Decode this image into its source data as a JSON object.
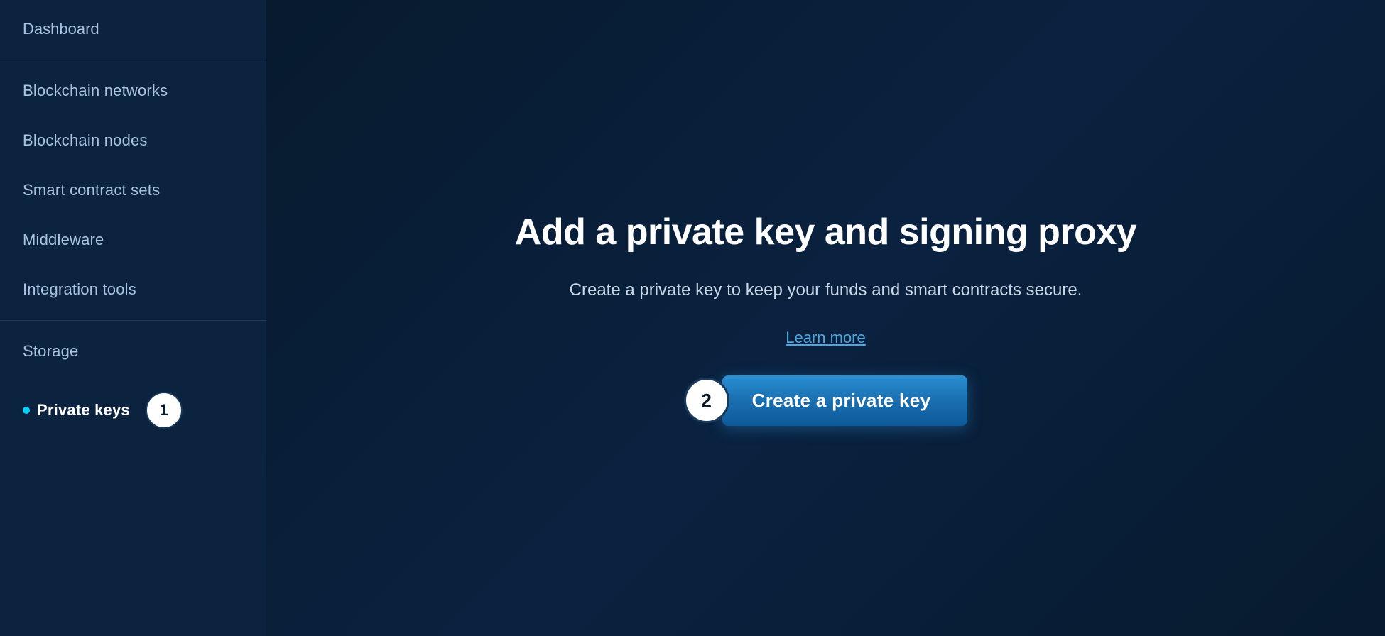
{
  "sidebar": {
    "dashboard_label": "Dashboard",
    "items": [
      {
        "id": "blockchain-networks",
        "label": "Blockchain networks",
        "active": false
      },
      {
        "id": "blockchain-nodes",
        "label": "Blockchain nodes",
        "active": false
      },
      {
        "id": "smart-contract-sets",
        "label": "Smart contract sets",
        "active": false
      },
      {
        "id": "middleware",
        "label": "Middleware",
        "active": false
      },
      {
        "id": "integration-tools",
        "label": "Integration tools",
        "active": false
      }
    ],
    "items_bottom": [
      {
        "id": "storage",
        "label": "Storage",
        "active": false
      },
      {
        "id": "private-keys",
        "label": "Private keys",
        "active": true,
        "dot": true
      }
    ],
    "step_badge_1": "1"
  },
  "main": {
    "title": "Add a private key and signing proxy",
    "subtitle": "Create a private key to keep your funds and smart contracts secure.",
    "learn_more_label": "Learn more",
    "step_badge_2": "2",
    "create_btn_label": "Create a private key"
  }
}
